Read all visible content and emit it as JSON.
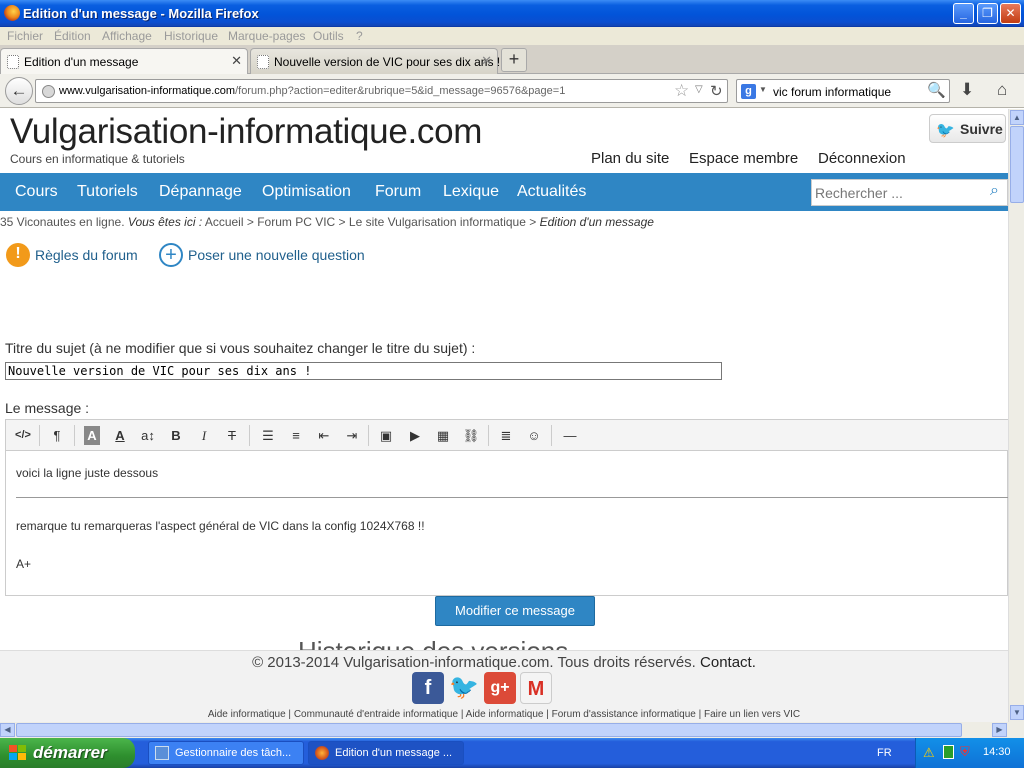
{
  "window": {
    "title": "Edition d'un message - Mozilla Firefox"
  },
  "menu": [
    "Fichier",
    "Édition",
    "Affichage",
    "Historique",
    "Marque-pages",
    "Outils",
    "?"
  ],
  "tabs": [
    {
      "label": "Edition d'un message",
      "active": true
    },
    {
      "label": "Nouvelle version de VIC pour ses dix ans !",
      "active": false
    }
  ],
  "nav": {
    "url_host": "www.vulgarisation-informatique.com",
    "url_path": "/forum.php?action=editer&rubrique=5&id_message=96576&page=1",
    "search_value": "vic  forum informatique"
  },
  "site": {
    "title": "Vulgarisation-informatique.com",
    "tagline": "Cours en informatique & tutoriels",
    "follow_label": "Suivre",
    "top_links": [
      "Plan du site",
      "Espace membre",
      "Déconnexion"
    ],
    "menu": [
      "Cours",
      "Tutoriels",
      "Dépannage",
      "Optimisation",
      "Forum",
      "Lexique",
      "Actualités"
    ],
    "search_placeholder": "Rechercher ..."
  },
  "breadcrumb": {
    "online": "35 Viconautes en ligne",
    "prefix": "Vous êtes ici :",
    "items": [
      "Accueil",
      "Forum PC VIC",
      "Le site Vulgarisation informatique"
    ],
    "current": "Edition d'un message"
  },
  "actions": {
    "rules": "Règles du forum",
    "new_question": "Poser une nouvelle question"
  },
  "form": {
    "title_label": "Titre du sujet (à ne modifier que si vous souhaitez changer le titre du sujet) :",
    "title_value": "Nouvelle version de VIC pour ses dix ans !",
    "message_label": "Le message :",
    "content_lines": [
      "voici la ligne juste dessous",
      "remarque tu remarqueras l'aspect général de VIC dans la config 1024X768 !!",
      "A+"
    ],
    "submit_label": "Modifier ce message",
    "ghost_text": "Historique des versions"
  },
  "footer": {
    "copyright": "© 2013-2014 Vulgarisation-informatique.com. Tous droits réservés.",
    "contact": "Contact.",
    "links": [
      "Aide informatique",
      "Communauté d'entraide informatique",
      "Aide informatique",
      "Forum d'assistance informatique",
      "Faire un lien vers VIC"
    ]
  },
  "taskbar": {
    "start": "démarrer",
    "tasks": [
      "Gestionnaire des tâch...",
      "Edition d'un message ..."
    ],
    "lang": "FR",
    "clock": "14:30"
  },
  "colors": {
    "accent": "#2f86c4",
    "xp_blue": "#245edb"
  }
}
